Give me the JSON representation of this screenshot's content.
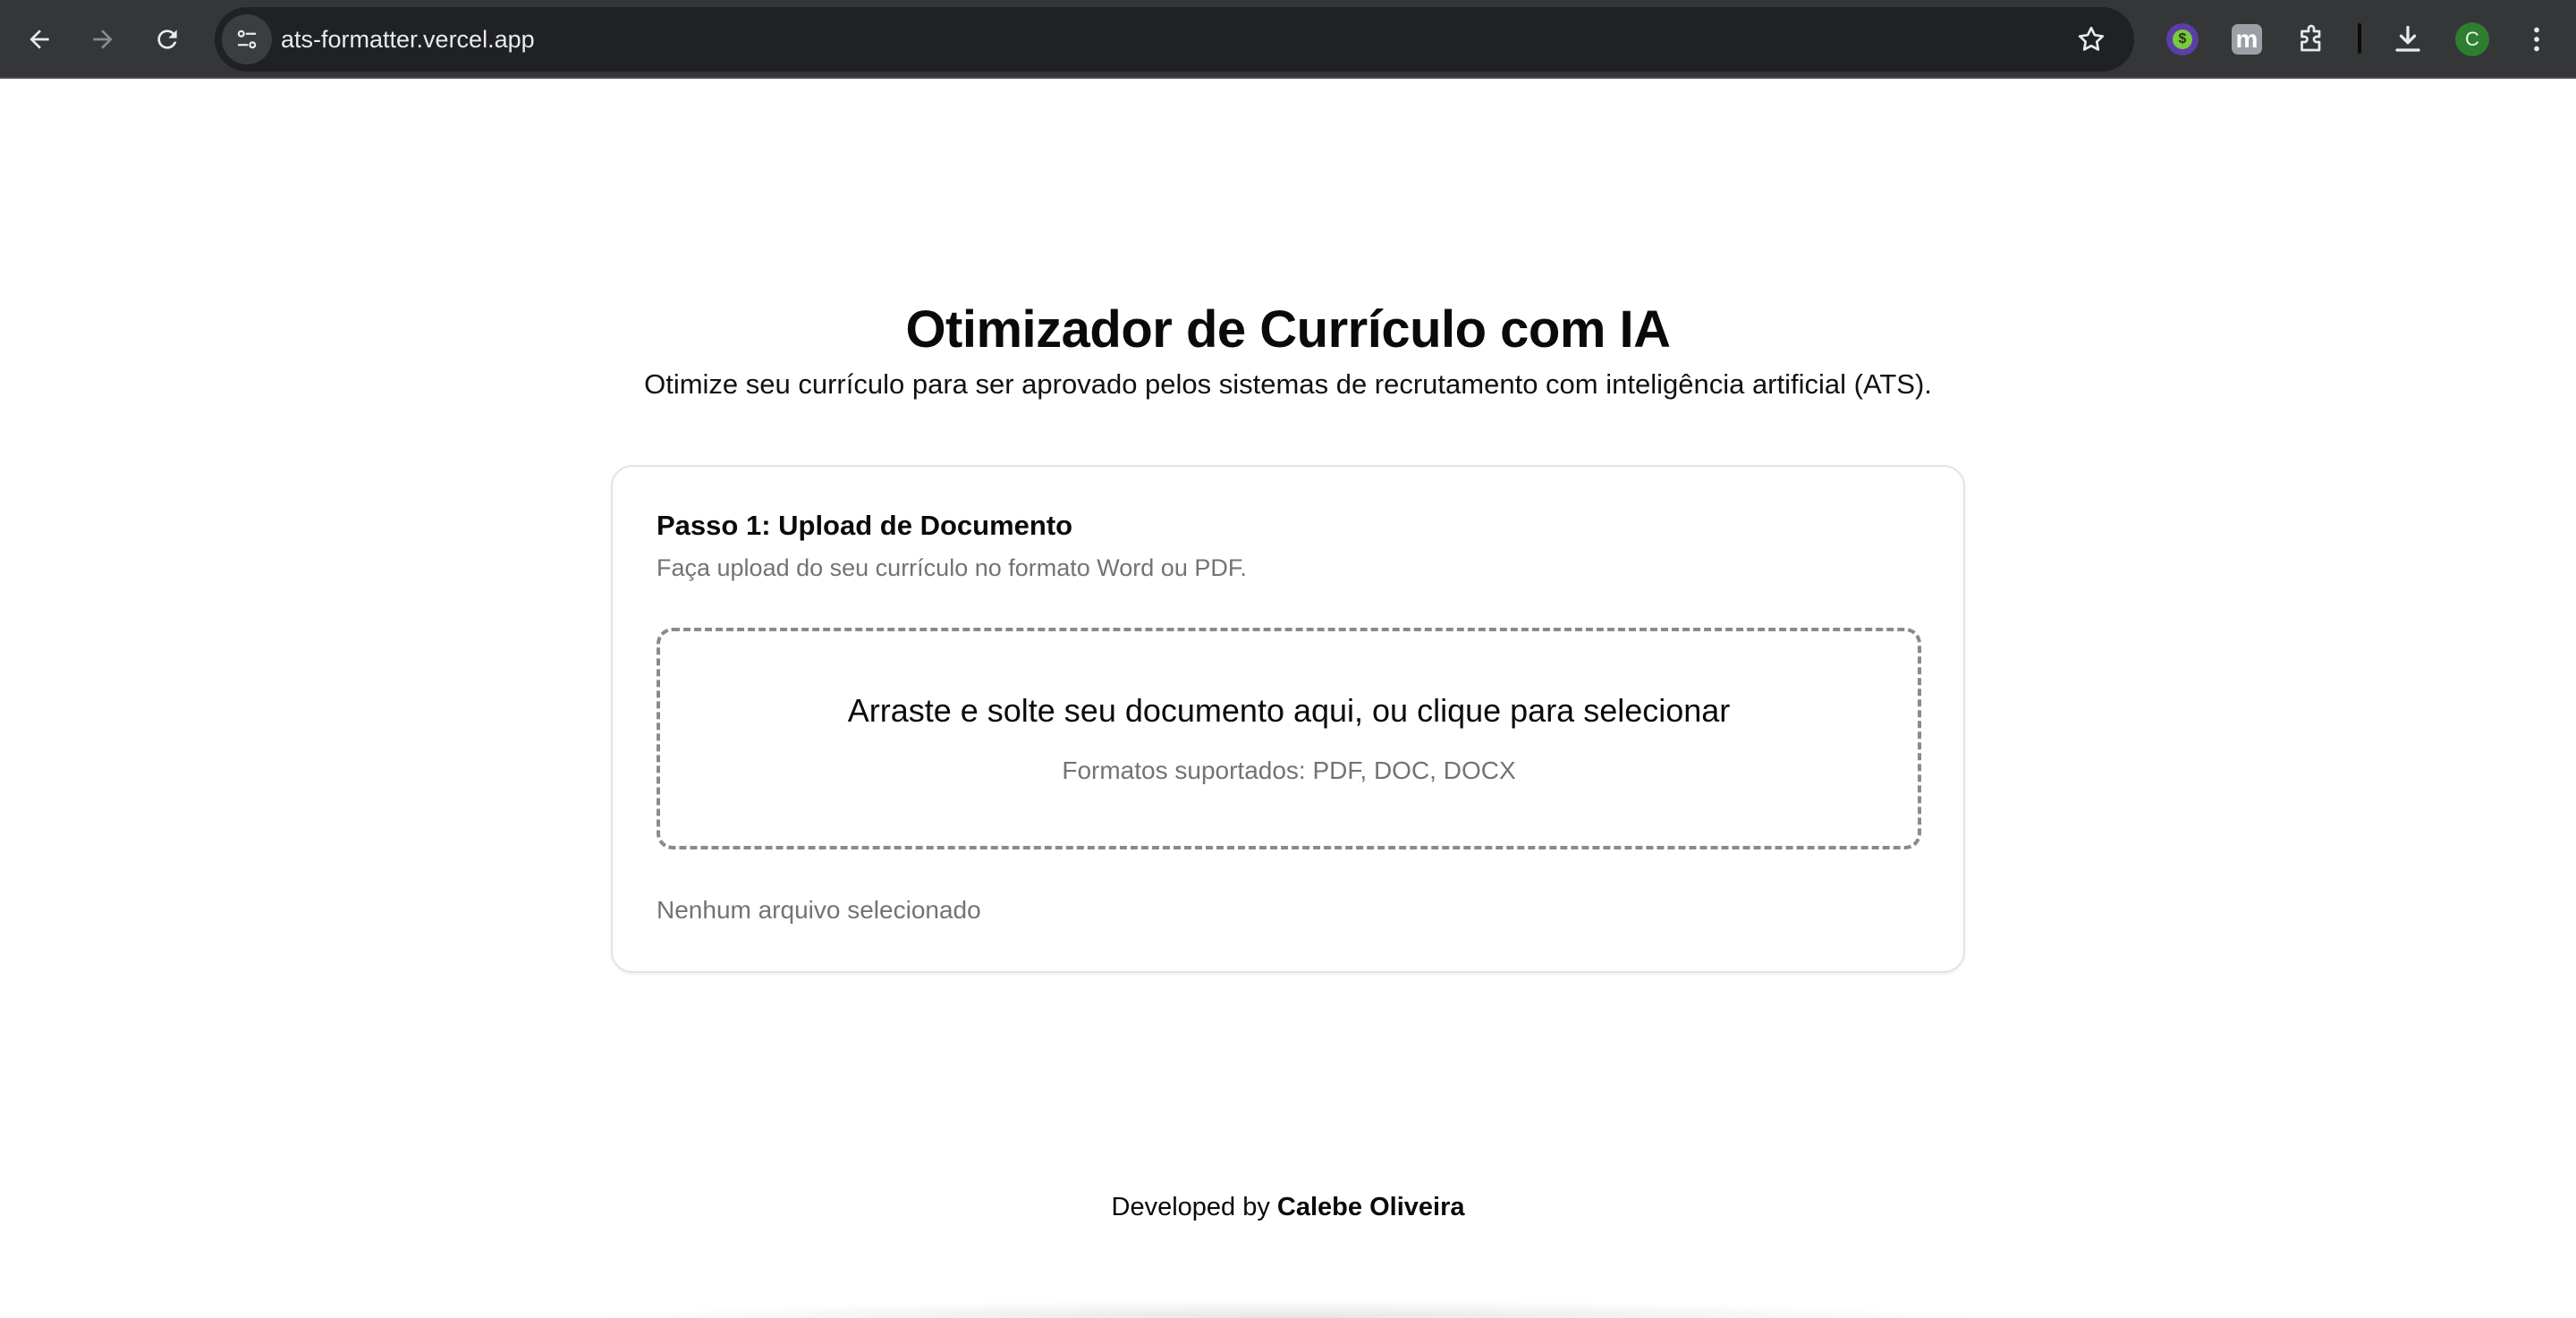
{
  "browser": {
    "url": "ats-formatter.vercel.app",
    "icons": {
      "back": "arrow-left-icon",
      "forward": "arrow-right-icon",
      "reload": "reload-icon",
      "site_info": "tune-icon",
      "bookmark": "star-icon",
      "extension1": "dollar-circle-icon",
      "extension2": "m-logo-icon",
      "extensions": "puzzle-icon",
      "downloads": "download-icon",
      "menu": "kebab-menu-icon"
    },
    "profile_initial": "C",
    "ext2_letter": "m",
    "ext1_symbol": "$",
    "colors": {
      "chrome_bg": "#353638",
      "omnibox_bg": "#202124",
      "profile": "#2e7d32"
    }
  },
  "header": {
    "title": "Otimizador de Currículo com IA",
    "subtitle": "Otimize seu currículo para ser aprovado pelos sistemas de recrutamento com inteligência artificial (ATS)."
  },
  "upload_card": {
    "title": "Passo 1: Upload de Documento",
    "description": "Faça upload do seu currículo no formato Word ou PDF.",
    "dropzone_label": "Arraste e solte seu documento aqui, ou clique para selecionar",
    "dropzone_formats": "Formatos suportados: PDF, DOC, DOCX",
    "file_status": "Nenhum arquivo selecionado"
  },
  "footer": {
    "prefix": "Developed by",
    "author": "Calebe Oliveira"
  }
}
